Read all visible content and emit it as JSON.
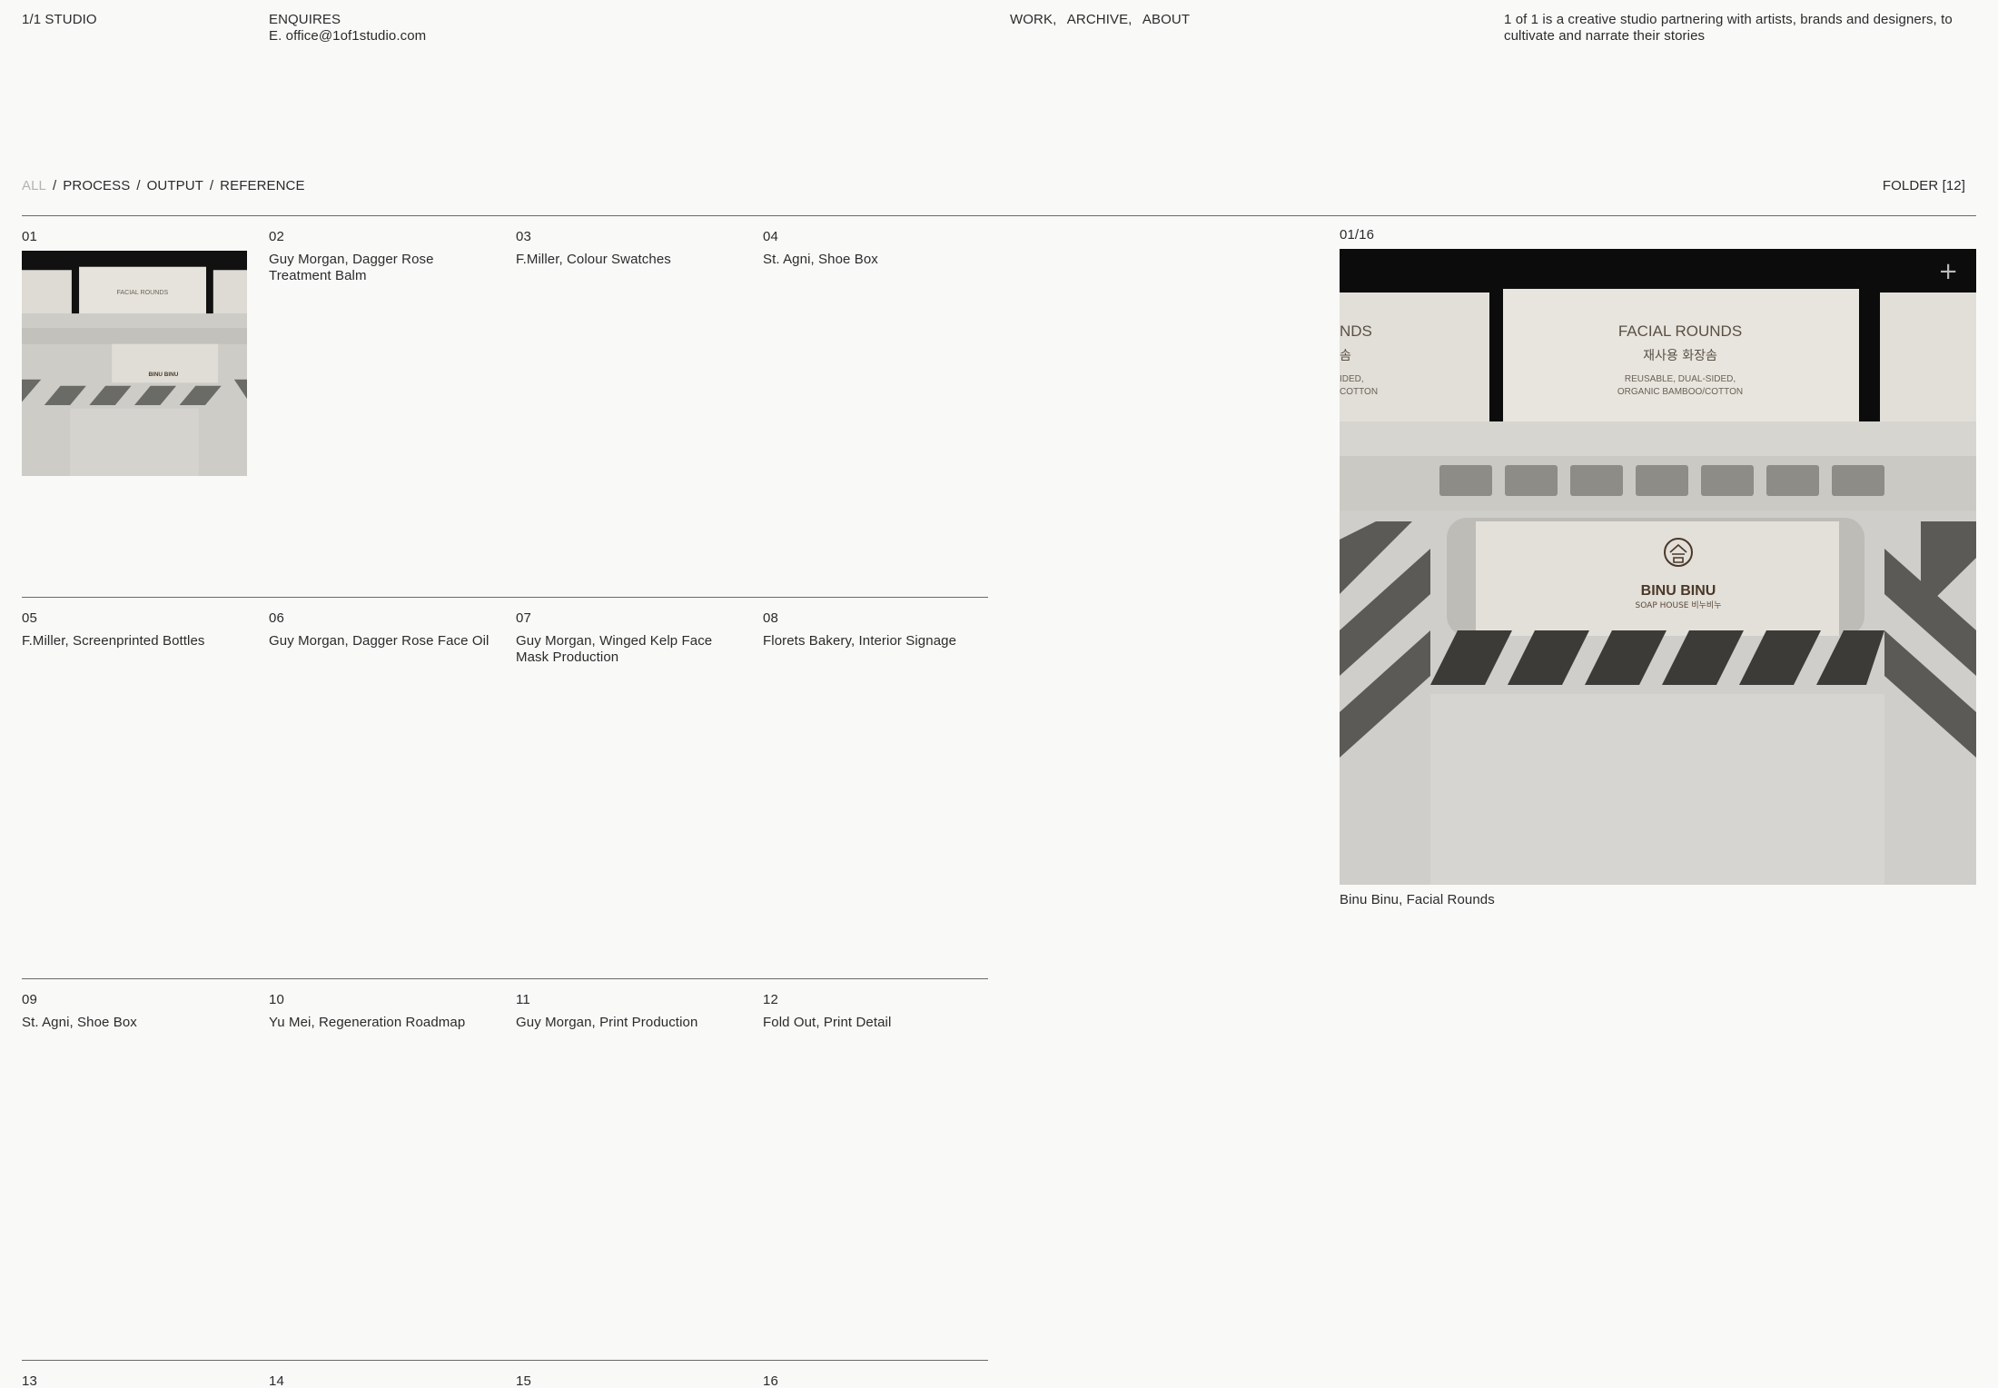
{
  "header": {
    "brand": "1/1 STUDIO",
    "enquiries_label": "ENQUIRES",
    "email": "E. office@1of1studio.com",
    "nav": [
      "WORK,",
      "ARCHIVE,",
      "ABOUT"
    ],
    "about_text": "1 of 1 is a creative studio partnering with artists, brands and designers, to cultivate and narrate their stories"
  },
  "filters": {
    "items": [
      "ALL",
      "PROCESS",
      "OUTPUT",
      "REFERENCE"
    ],
    "separator": "/",
    "active": "ALL"
  },
  "folder_label": "FOLDER [12]",
  "grid": {
    "items": [
      {
        "num": "01",
        "title": ""
      },
      {
        "num": "02",
        "title": "Guy Morgan, Dagger Rose Treatment Balm"
      },
      {
        "num": "03",
        "title": "F.Miller, Colour Swatches"
      },
      {
        "num": "04",
        "title": "St. Agni, Shoe Box"
      },
      {
        "num": "05",
        "title": "F.Miller, Screenprinted Bottles"
      },
      {
        "num": "06",
        "title": "Guy Morgan, Dagger Rose Face Oil"
      },
      {
        "num": "07",
        "title": "Guy Morgan, Winged Kelp Face Mask Production"
      },
      {
        "num": "08",
        "title": "Florets Bakery, Interior Signage"
      },
      {
        "num": "09",
        "title": "St. Agni, Shoe Box"
      },
      {
        "num": "10",
        "title": "Yu Mei, Regeneration Roadmap"
      },
      {
        "num": "11",
        "title": "Guy Morgan, Print Production"
      },
      {
        "num": "12",
        "title": "Fold Out, Print Detail"
      },
      {
        "num": "13",
        "title": ""
      },
      {
        "num": "14",
        "title": ""
      },
      {
        "num": "15",
        "title": ""
      },
      {
        "num": "16",
        "title": ""
      }
    ]
  },
  "preview": {
    "counter": "01/16",
    "caption": "Binu Binu, Facial Rounds",
    "plus_icon": "+",
    "card_center_title": "FACIAL ROUNDS",
    "card_center_korean": "재사용 화장솜",
    "card_center_sub1": "REUSABLE, DUAL-SIDED,",
    "card_center_sub2": "ORGANIC BAMBOO/COTTON",
    "card_left_title": "NDS",
    "card_left_korean": "솜",
    "card_left_sub1": "IDED,",
    "card_left_sub2": "COTTON",
    "logo_text": "BINU BINU",
    "logo_sub": "SOAP HOUSE 비누비누"
  }
}
